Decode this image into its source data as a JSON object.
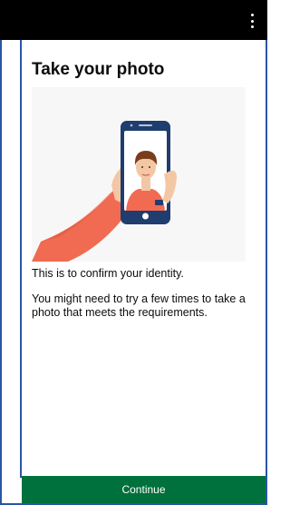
{
  "header": {
    "menu_icon": "more-vertical-icon"
  },
  "page": {
    "title": "Take your photo",
    "illustration": "selfie-phone-illustration",
    "paragraph1": "This is to confirm your identity.",
    "paragraph2": "You might need to try a few times to take a photo that meets the requirements."
  },
  "actions": {
    "continue_label": "Continue"
  },
  "colors": {
    "topbar": "#000000",
    "primary_button": "#00703c",
    "frame_border": "#2b55a5"
  }
}
